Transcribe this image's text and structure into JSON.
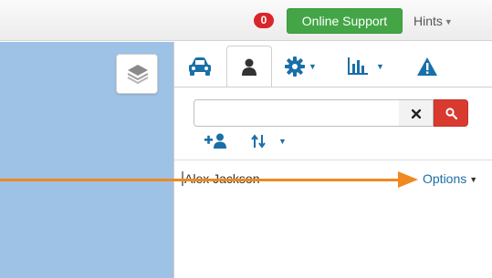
{
  "topbar": {
    "notification_count": "0",
    "support_label": "Online Support",
    "hints_label": "Hints"
  },
  "toolbar": {
    "tabs": [
      {
        "name": "vehicles",
        "icon": "car-icon"
      },
      {
        "name": "users",
        "icon": "user-icon",
        "active": true
      },
      {
        "name": "settings",
        "icon": "gear-icon"
      },
      {
        "name": "reports",
        "icon": "bar-chart-icon"
      },
      {
        "name": "alerts",
        "icon": "warning-icon"
      }
    ]
  },
  "search": {
    "value": "",
    "placeholder": ""
  },
  "users": [
    {
      "name": "Alex Jackson",
      "options_label": "Options"
    }
  ],
  "colors": {
    "badge": "#d9262a",
    "support_button": "#43a546",
    "search_button": "#d93a30",
    "accent_blue": "#1a6fa8",
    "map": "#9dc2e6",
    "annotation_arrow": "#f0891f"
  }
}
